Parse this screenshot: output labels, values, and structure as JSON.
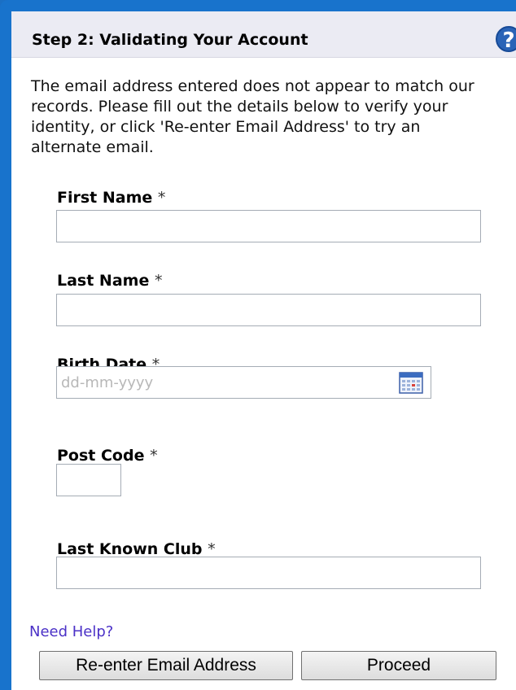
{
  "header": {
    "title": "Step 2: Validating Your Account",
    "help_icon_glyph": "?"
  },
  "intro": "The email address entered does not appear to match our records. Please fill out the details below to verify your identity, or click 'Re-enter Email Address' to try an alternate email.",
  "fields": {
    "first_name": {
      "label": "First Name",
      "required_mark": "*",
      "value": ""
    },
    "last_name": {
      "label": "Last Name",
      "required_mark": "*",
      "value": ""
    },
    "birth_date": {
      "label": "Birth Date",
      "required_mark": "*",
      "placeholder": "dd-mm-yyyy",
      "value": ""
    },
    "post_code": {
      "label": "Post Code",
      "required_mark": "*",
      "value": ""
    },
    "last_known_club": {
      "label": "Last Known Club",
      "required_mark": "*",
      "value": ""
    }
  },
  "links": {
    "need_help": "Need Help?"
  },
  "buttons": {
    "reenter_email": "Re-enter Email Address",
    "proceed": "Proceed"
  },
  "colors": {
    "frame_blue": "#1873cc",
    "header_bg": "#ebebf3",
    "link": "#4b31c7"
  },
  "icons": {
    "help": "question-circle-icon",
    "calendar": "calendar-icon"
  }
}
